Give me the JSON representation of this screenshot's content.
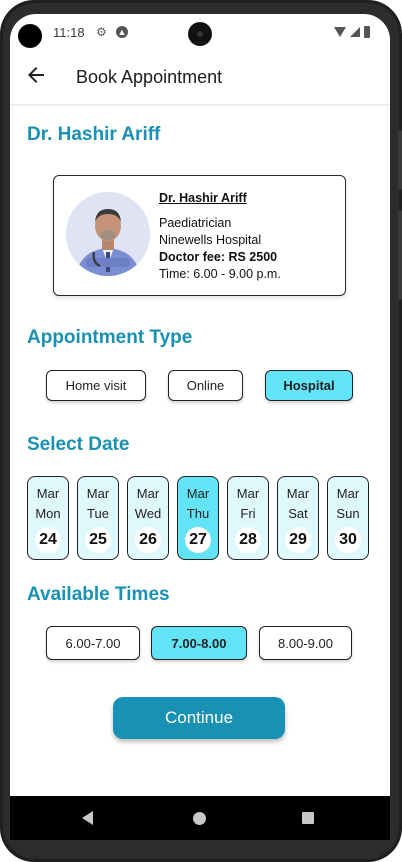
{
  "status_bar": {
    "time": "11:18"
  },
  "app_bar": {
    "title": "Book Appointment"
  },
  "doctor_heading": "Dr. Hashir Ariff",
  "doctor_card": {
    "name": "Dr. Hashir Ariff",
    "specialty": "Paediatrician",
    "hospital": "Ninewells Hospital",
    "fee": "Doctor fee: RS 2500",
    "time": "Time: 6.00 - 9.00 p.m."
  },
  "appointment_type": {
    "heading": "Appointment Type",
    "options": [
      "Home visit",
      "Online",
      "Hospital"
    ],
    "selected": "Hospital"
  },
  "select_date": {
    "heading": "Select Date",
    "dates": [
      {
        "month": "Mar",
        "day": "Mon",
        "num": "24"
      },
      {
        "month": "Mar",
        "day": "Tue",
        "num": "25"
      },
      {
        "month": "Mar",
        "day": "Wed",
        "num": "26"
      },
      {
        "month": "Mar",
        "day": "Thu",
        "num": "27"
      },
      {
        "month": "Mar",
        "day": "Fri",
        "num": "28"
      },
      {
        "month": "Mar",
        "day": "Sat",
        "num": "29"
      },
      {
        "month": "Mar",
        "day": "Sun",
        "num": "30"
      }
    ],
    "selected": "27"
  },
  "available_times": {
    "heading": "Available Times",
    "slots": [
      "6.00-7.00",
      "7.00-8.00",
      "8.00-9.00"
    ],
    "selected": "7.00-8.00"
  },
  "continue_label": "Continue",
  "colors": {
    "accent": "#1991b4",
    "selected": "#62e3f6",
    "date_bg": "#dff8fc"
  }
}
